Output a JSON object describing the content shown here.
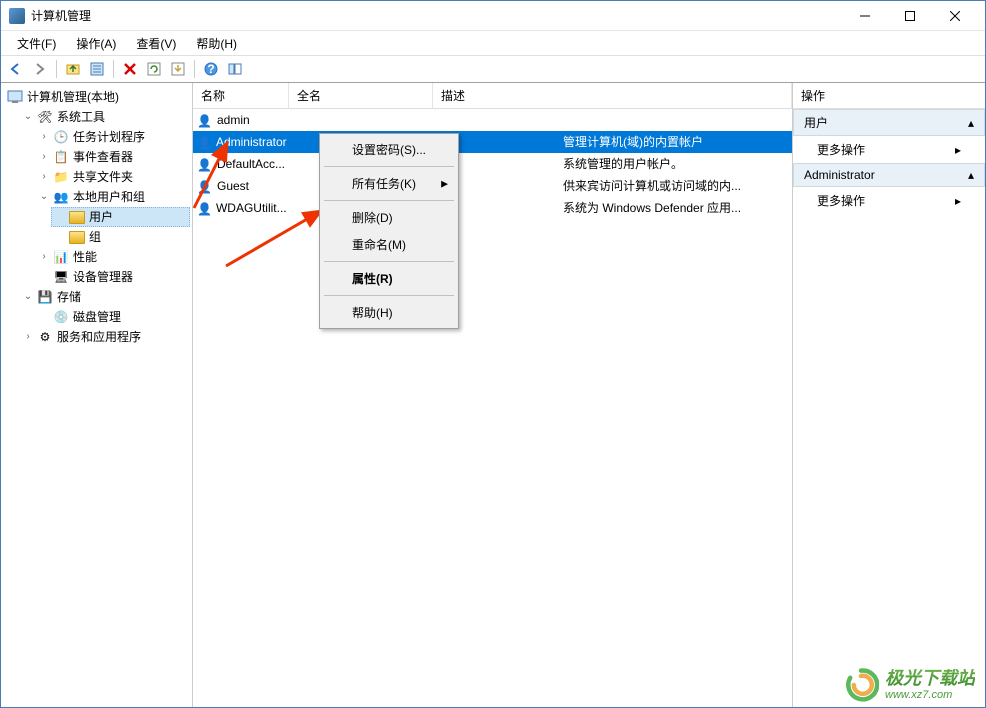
{
  "window": {
    "title": "计算机管理"
  },
  "menubar": {
    "file": "文件(F)",
    "action": "操作(A)",
    "view": "查看(V)",
    "help": "帮助(H)"
  },
  "tree": {
    "root": "计算机管理(本地)",
    "sys_tools": "系统工具",
    "task_scheduler": "任务计划程序",
    "event_viewer": "事件查看器",
    "shared_folders": "共享文件夹",
    "local_users": "本地用户和组",
    "users": "用户",
    "groups": "组",
    "performance": "性能",
    "device_manager": "设备管理器",
    "storage": "存储",
    "disk_mgmt": "磁盘管理",
    "services_apps": "服务和应用程序"
  },
  "list": {
    "headers": {
      "name": "名称",
      "fullname": "全名",
      "description": "描述"
    },
    "rows": [
      {
        "name": "admin",
        "fullname": "",
        "desc": ""
      },
      {
        "name": "Administrator",
        "fullname": "",
        "desc": "管理计算机(域)的内置帐户"
      },
      {
        "name": "DefaultAcc...",
        "fullname": "",
        "desc": "系统管理的用户帐户。"
      },
      {
        "name": "Guest",
        "fullname": "",
        "desc": "供来宾访问计算机或访问域的内..."
      },
      {
        "name": "WDAGUtilit...",
        "fullname": "",
        "desc": "系统为 Windows Defender 应用..."
      }
    ]
  },
  "actions": {
    "header": "操作",
    "section1": "用户",
    "more1": "更多操作",
    "section2": "Administrator",
    "more2": "更多操作"
  },
  "context": {
    "set_password": "设置密码(S)...",
    "all_tasks": "所有任务(K)",
    "delete": "删除(D)",
    "rename": "重命名(M)",
    "properties": "属性(R)",
    "help": "帮助(H)"
  },
  "watermark": {
    "cn": "极光下载站",
    "url": "www.xz7.com"
  }
}
